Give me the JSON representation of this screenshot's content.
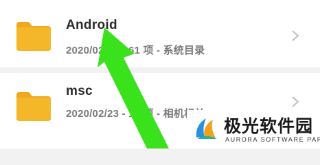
{
  "files": [
    {
      "name": "Android",
      "meta": "2020/02/23 - 61 项 - 系统目录"
    },
    {
      "name": "msc",
      "meta": "2020/02/23 - 12 项 - 相机相关"
    }
  ],
  "watermark": {
    "title": "极光软件园",
    "subtitle": "AURORA SOFTWARE PARK"
  },
  "colors": {
    "folder": "#f5b72a",
    "folder_tab": "#f0a81c",
    "arrow": "#39e21b",
    "chevron": "#bdbdbd"
  },
  "icons": {
    "folder": "folder-icon",
    "chevron": "chevron-right-icon",
    "annotation": "arrow-annotation",
    "logo": "aurora-logo"
  }
}
